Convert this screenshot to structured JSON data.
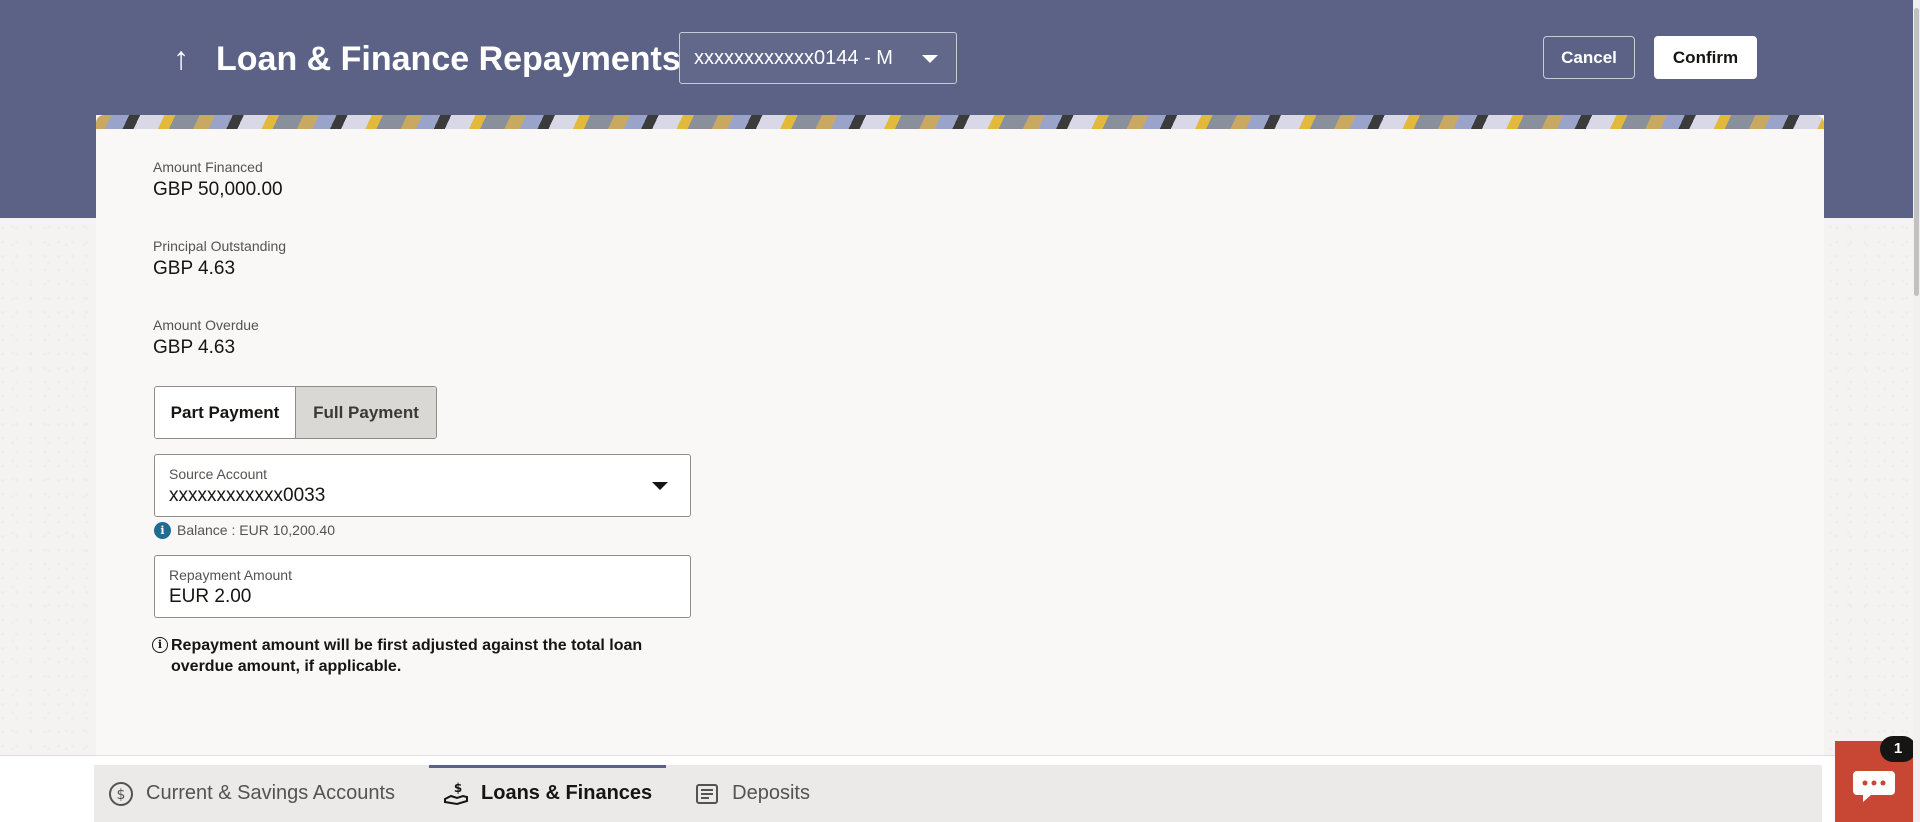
{
  "header": {
    "title": "Loan & Finance Repayments",
    "account_selector": "xxxxxxxxxxxx0144 - M",
    "cancel_label": "Cancel",
    "confirm_label": "Confirm"
  },
  "details": {
    "amount_financed_label": "Amount Financed",
    "amount_financed_value": "GBP 50,000.00",
    "principal_outstanding_label": "Principal Outstanding",
    "principal_outstanding_value": "GBP 4.63",
    "amount_overdue_label": "Amount Overdue",
    "amount_overdue_value": "GBP 4.63"
  },
  "payment_type": {
    "part_label": "Part Payment",
    "full_label": "Full Payment",
    "selected": "Full Payment"
  },
  "source_account": {
    "label": "Source Account",
    "value": "xxxxxxxxxxxx0033",
    "balance_text": "Balance : EUR 10,200.40"
  },
  "repayment_amount": {
    "label": "Repayment Amount",
    "value": "EUR 2.00"
  },
  "note": "Repayment amount will be first adjusted against the total loan overdue amount, if applicable.",
  "bottom_tabs": [
    {
      "label": "Current & Savings Accounts",
      "icon": "dollar-circle-icon",
      "active": false
    },
    {
      "label": "Loans & Finances",
      "icon": "hand-money-icon",
      "active": true
    },
    {
      "label": "Deposits",
      "icon": "deposits-icon",
      "active": false
    }
  ],
  "chat": {
    "badge": "1",
    "icon": "chat-bubble-icon"
  },
  "colors": {
    "header": "#5b6286",
    "accent": "#c74634",
    "info": "#1f6c93"
  }
}
